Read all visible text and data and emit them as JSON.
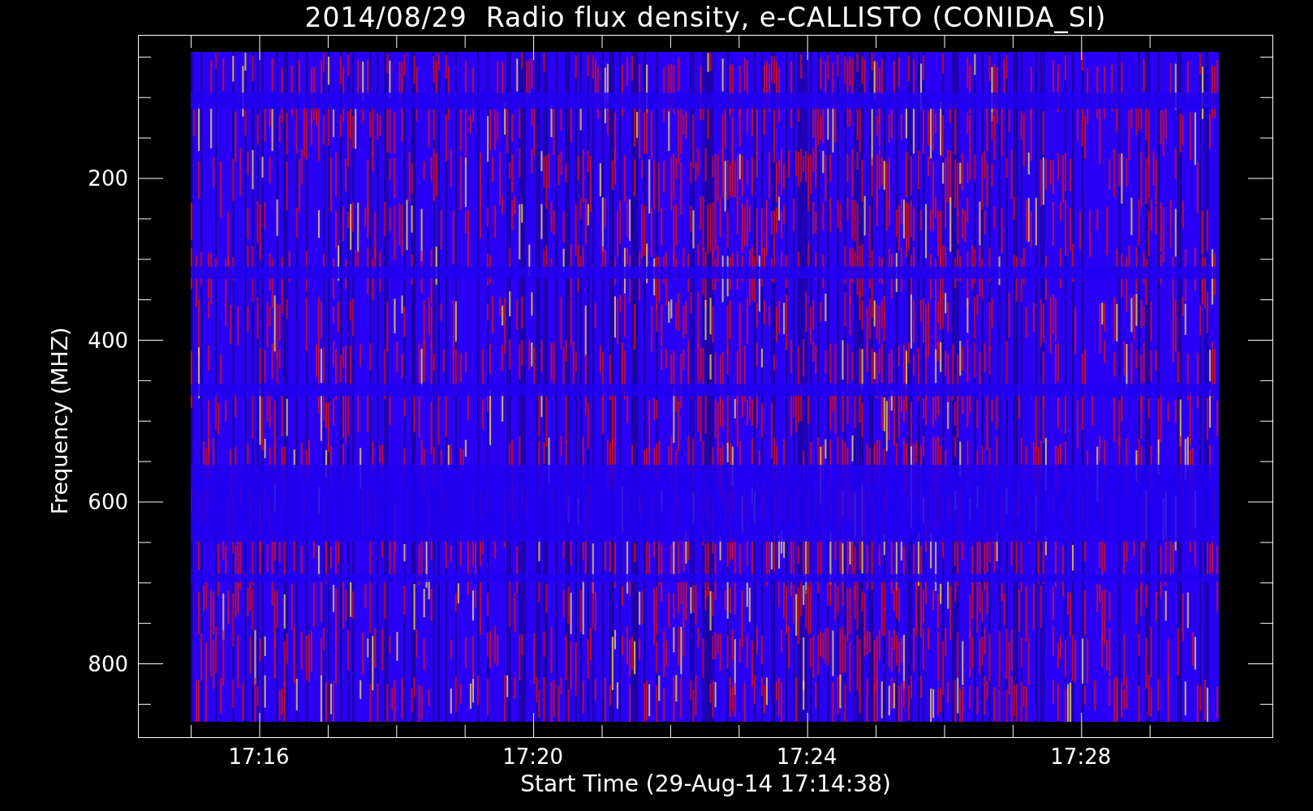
{
  "title": "2014/08/29  Radio flux density, e-CALLISTO (CONIDA_SI)",
  "y_axis": {
    "label": "Frequency (MHZ)",
    "ticks": [
      "200",
      "400",
      "600",
      "800"
    ]
  },
  "x_axis": {
    "label": "Start Time (29-Aug-14 17:14:38)",
    "ticks": [
      "17:16",
      "17:20",
      "17:24",
      "17:28"
    ]
  }
}
